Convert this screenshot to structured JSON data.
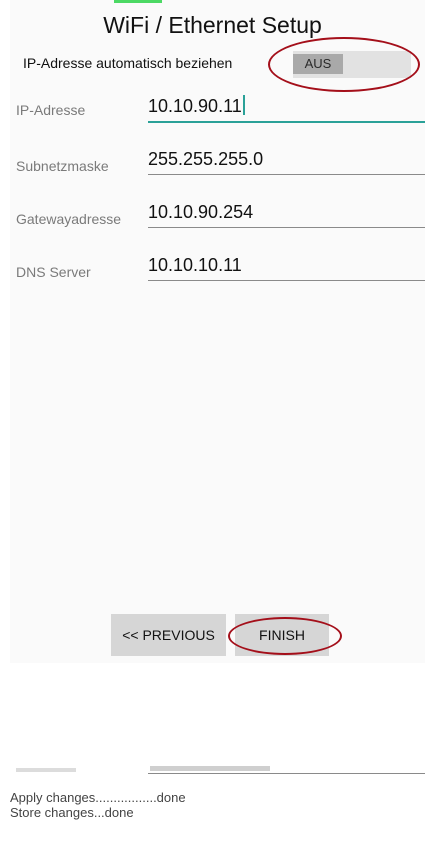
{
  "header": {
    "title": "WiFi / Ethernet Setup"
  },
  "toggle": {
    "label": "IP-Adresse automatisch beziehen",
    "state": "AUS"
  },
  "fields": [
    {
      "label": "IP-Adresse",
      "value": "10.10.90.11"
    },
    {
      "label": "Subnetzmaske",
      "value": "255.255.255.0"
    },
    {
      "label": "Gatewayadresse",
      "value": "10.10.90.254"
    },
    {
      "label": "DNS Server",
      "value": "10.10.10.11"
    }
  ],
  "buttons": {
    "previous": "<< PREVIOUS",
    "finish": "FINISH"
  },
  "log": [
    "Apply changes.................done",
    "Store changes...done"
  ],
  "colors": {
    "accent": "#2aa198",
    "annotation": "#a40f1a",
    "button": "#d6d6d6"
  }
}
